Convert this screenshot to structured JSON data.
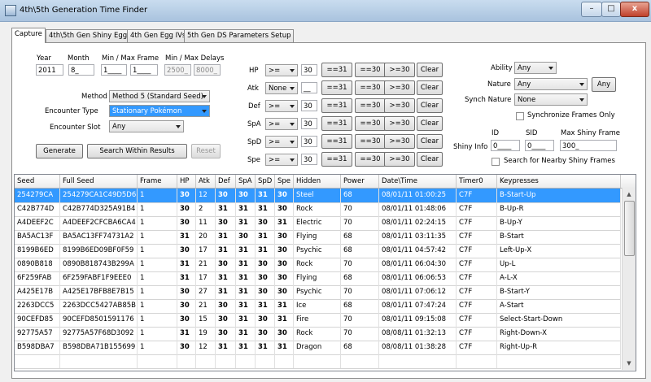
{
  "window": {
    "title": "4th\\5th Generation Time Finder",
    "minimize": "–",
    "maximize": "□",
    "close": "x"
  },
  "tabs": [
    "Capture",
    "4th\\5th Gen Shiny Egg",
    "4th Gen Egg IVs",
    "5th Gen DS Parameters Setup"
  ],
  "form": {
    "year_label": "Year",
    "year": "2011",
    "month_label": "Month",
    "month": "8_",
    "frame_label": "Min / Max Frame",
    "min_frame": "1____",
    "max_frame": "1____",
    "delay_label": "Min / Max Delays",
    "min_delay": "2500_",
    "max_delay": "8000_",
    "method_label": "Method",
    "method": "Method 5 (Standard Seed)",
    "encounter_type_label": "Encounter Type",
    "encounter_type": "Stationary Pokémon",
    "encounter_slot_label": "Encounter Slot",
    "encounter_slot": "Any",
    "generate": "Generate",
    "search_within": "Search Within Results",
    "reset": "Reset"
  },
  "ivs": [
    {
      "stat": "HP",
      "op": ">=",
      "value": "30"
    },
    {
      "stat": "Atk",
      "op": "None",
      "value": "__"
    },
    {
      "stat": "Def",
      "op": ">=",
      "value": "30"
    },
    {
      "stat": "SpA",
      "op": ">=",
      "value": "30"
    },
    {
      "stat": "SpD",
      "op": ">=",
      "value": "30"
    },
    {
      "stat": "Spe",
      "op": ">=",
      "value": "30"
    }
  ],
  "iv_buttons": {
    "eq31": "==31",
    "eq30": "==30",
    "ge30": ">=30",
    "clear": "Clear"
  },
  "right": {
    "ability_label": "Ability",
    "ability": "Any",
    "nature_label": "Nature",
    "nature": "Any",
    "nature_btn": "Any",
    "synch_label": "Synch Nature",
    "synch": "None",
    "sync_frames": "Synchronize Frames Only",
    "id_label": "ID",
    "id": "0____",
    "sid_label": "SID",
    "sid": "0____",
    "max_shiny_label": "Max Shiny Frame",
    "max_shiny": "300_",
    "shiny_info": "Shiny Info",
    "nearby": "Search for Nearby Shiny Frames"
  },
  "grid": {
    "columns": [
      "Seed",
      "Full Seed",
      "Frame",
      "HP",
      "Atk",
      "Def",
      "SpA",
      "SpD",
      "Spe",
      "Hidden",
      "Power",
      "Date\\Time",
      "Timer0",
      "Keypresses"
    ],
    "rows": [
      [
        "254279CA",
        "254279CA1C49D5D6",
        "1",
        "30",
        "12",
        "30",
        "30",
        "31",
        "30",
        "Steel",
        "68",
        "08/01/11 01:00:25",
        "C7F",
        "B-Start-Up"
      ],
      [
        "C42B774D",
        "C42B774D325A91B4",
        "1",
        "30",
        "2",
        "31",
        "31",
        "31",
        "30",
        "Rock",
        "70",
        "08/01/11 01:48:06",
        "C7F",
        "B-Up-R"
      ],
      [
        "A4DEEF2C",
        "A4DEEF2CFCBA6CA4",
        "1",
        "30",
        "11",
        "30",
        "31",
        "30",
        "31",
        "Electric",
        "70",
        "08/01/11 02:24:15",
        "C7F",
        "B-Up-Y"
      ],
      [
        "BA5AC13F",
        "BA5AC13FF74731A2",
        "1",
        "31",
        "20",
        "31",
        "30",
        "31",
        "30",
        "Flying",
        "68",
        "08/01/11 03:11:35",
        "C7F",
        "B-Start"
      ],
      [
        "8199B6ED",
        "8199B6ED09BF0F59",
        "1",
        "30",
        "17",
        "31",
        "31",
        "31",
        "30",
        "Psychic",
        "68",
        "08/01/11 04:57:42",
        "C7F",
        "Left-Up-X"
      ],
      [
        "0890B818",
        "0890B818743B299A",
        "1",
        "31",
        "21",
        "30",
        "31",
        "30",
        "30",
        "Rock",
        "70",
        "08/01/11 06:04:30",
        "C7F",
        "Up-L"
      ],
      [
        "6F259FAB",
        "6F259FABF1F9EEE0",
        "1",
        "31",
        "17",
        "31",
        "31",
        "30",
        "30",
        "Flying",
        "68",
        "08/01/11 06:06:53",
        "C7F",
        "A-L-X"
      ],
      [
        "A425E17B",
        "A425E17BFB8E7B15",
        "1",
        "30",
        "27",
        "31",
        "31",
        "30",
        "30",
        "Psychic",
        "70",
        "08/01/11 07:06:12",
        "C7F",
        "B-Start-Y"
      ],
      [
        "2263DCC5",
        "2263DCC5427AB85B",
        "1",
        "30",
        "21",
        "30",
        "31",
        "31",
        "31",
        "Ice",
        "68",
        "08/01/11 07:47:24",
        "C7F",
        "A-Start"
      ],
      [
        "90CEFD85",
        "90CEFD8501591176",
        "1",
        "30",
        "15",
        "30",
        "31",
        "30",
        "31",
        "Fire",
        "70",
        "08/01/11 09:15:08",
        "C7F",
        "Select-Start-Down"
      ],
      [
        "92775A57",
        "92775A57F68D3092",
        "1",
        "31",
        "19",
        "30",
        "31",
        "30",
        "30",
        "Rock",
        "70",
        "08/08/11 01:32:13",
        "C7F",
        "Right-Down-X"
      ],
      [
        "B598DBA7",
        "B598DBA71B155699",
        "1",
        "30",
        "12",
        "31",
        "31",
        "31",
        "31",
        "Dragon",
        "68",
        "08/08/11 01:38:28",
        "C7F",
        "Right-Up-R"
      ],
      [
        "",
        "",
        "",
        "",
        "",
        "",
        "",
        "",
        "",
        "",
        "",
        "",
        "",
        ""
      ]
    ]
  }
}
